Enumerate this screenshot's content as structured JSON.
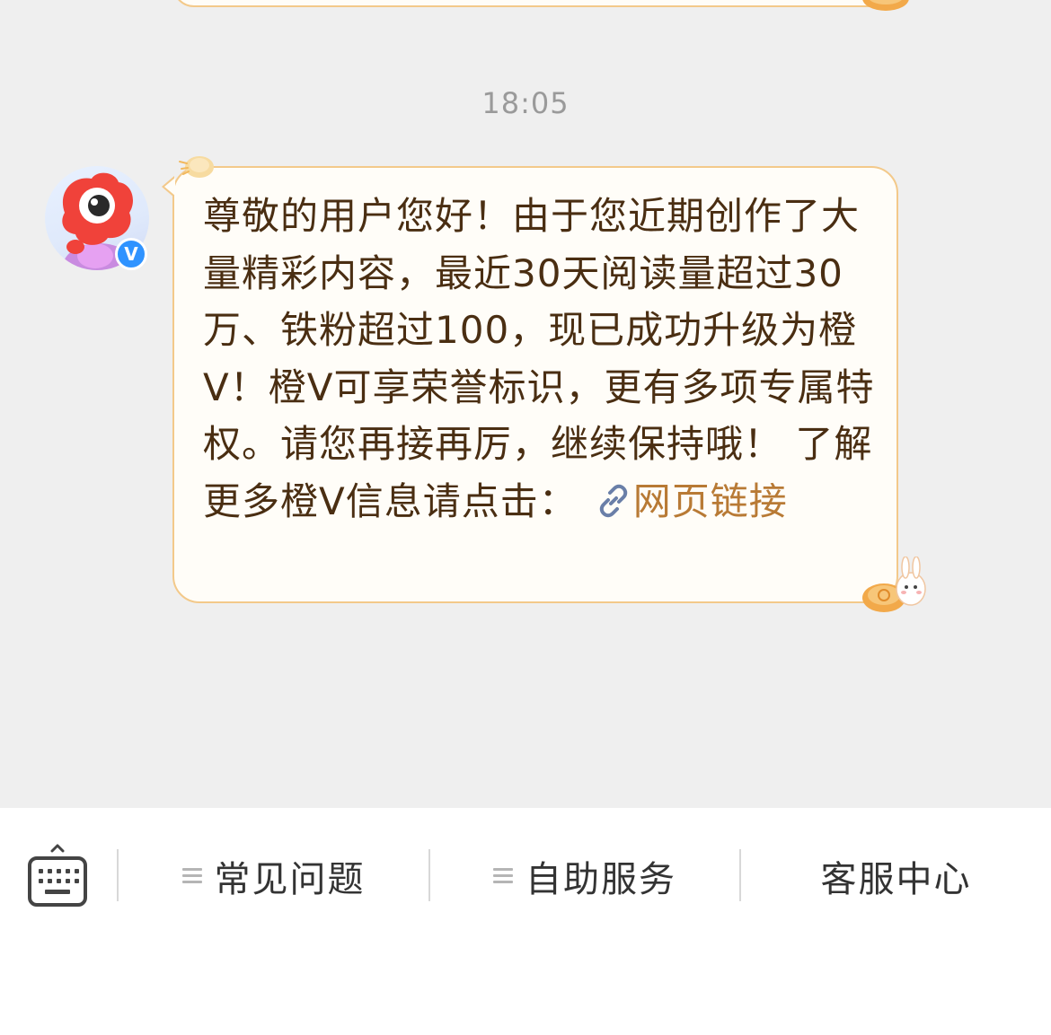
{
  "chat": {
    "timestamp": "18:05",
    "message": {
      "text": "尊敬的用户您好！由于您近期创作了大量精彩内容，最近30天阅读量超过30万、铁粉超过100，现已成功升级为橙V！橙V可享荣誉标识，更有多项专属特权。请您再接再厉，继续保持哦！ 了解更多橙V信息请点击：",
      "link_label": "网页链接"
    },
    "avatar_badge": "V"
  },
  "toolbar": {
    "keyboard_icon": "keyboard-icon",
    "items": [
      {
        "label": "常见问题",
        "icon": "menu-icon"
      },
      {
        "label": "自助服务",
        "icon": "menu-icon"
      },
      {
        "label": "客服中心"
      }
    ]
  },
  "colors": {
    "background": "#efefef",
    "bubble_border": "#f3c98a",
    "bubble_fill": "#fffdf8",
    "message_text": "#4a2e12",
    "link_text": "#b87a35",
    "verify_badge": "#2f93ff"
  }
}
